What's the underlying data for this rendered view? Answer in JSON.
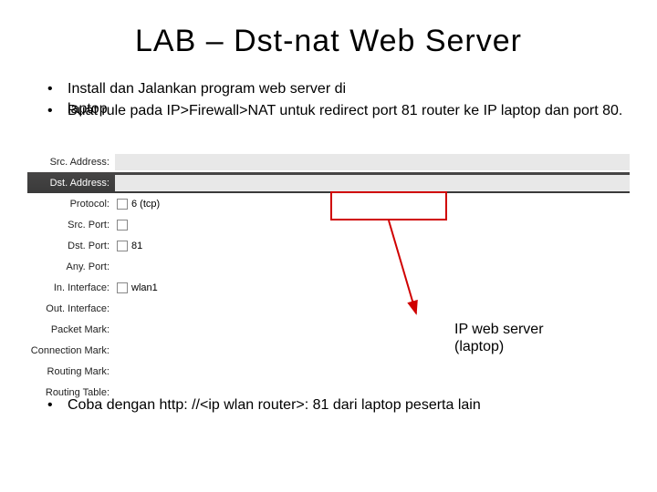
{
  "title": "LAB – Dst-nat Web Server",
  "bullets": {
    "b1_line1": "Install dan Jalankan program web server di",
    "b1_line2a": "laptop",
    "b2": "Buat rule pada IP>Firewall>NAT untuk redirect port 81 router ke IP laptop dan port 80."
  },
  "form": {
    "rows": [
      {
        "label": "Src. Address:",
        "type": "big",
        "value": ""
      },
      {
        "label": "Dst. Address:",
        "type": "big",
        "value": ""
      },
      {
        "label": "Protocol:",
        "type": "check",
        "value": "6 (tcp)"
      },
      {
        "label": "Src. Port:",
        "type": "check",
        "value": ""
      },
      {
        "label": "Dst. Port:",
        "type": "check",
        "value": "81"
      },
      {
        "label": "Any. Port:",
        "type": "plain",
        "value": ""
      },
      {
        "label": "In. Interface:",
        "type": "check",
        "value": "wlan1"
      },
      {
        "label": "Out. Interface:",
        "type": "plain",
        "value": ""
      },
      {
        "label": "Packet Mark:",
        "type": "plain",
        "value": ""
      },
      {
        "label": "Connection Mark:",
        "type": "plain",
        "value": ""
      },
      {
        "label": "Routing Mark:",
        "type": "plain",
        "value": ""
      },
      {
        "label": "Routing Table:",
        "type": "plain",
        "value": ""
      }
    ]
  },
  "callout": {
    "line1": "IP web server",
    "line2": "(laptop)"
  },
  "bottom": "Coba dengan http: //<ip wlan router>: 81 dari laptop peserta lain"
}
